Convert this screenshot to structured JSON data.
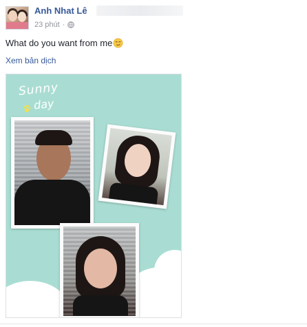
{
  "post": {
    "author": "Anh Nhat Lê",
    "time": "23 phút",
    "separator": "·",
    "text": "What do you want from me",
    "translate_link": "Xem bản dịch"
  },
  "photo": {
    "line1": "Sunny",
    "line2": "day"
  },
  "colors": {
    "link": "#365899",
    "meta": "#90949c",
    "photo_bg": "#a9ddd3"
  },
  "icons": {
    "privacy": "globe-icon",
    "emoji": "smirk-emoji-icon"
  }
}
